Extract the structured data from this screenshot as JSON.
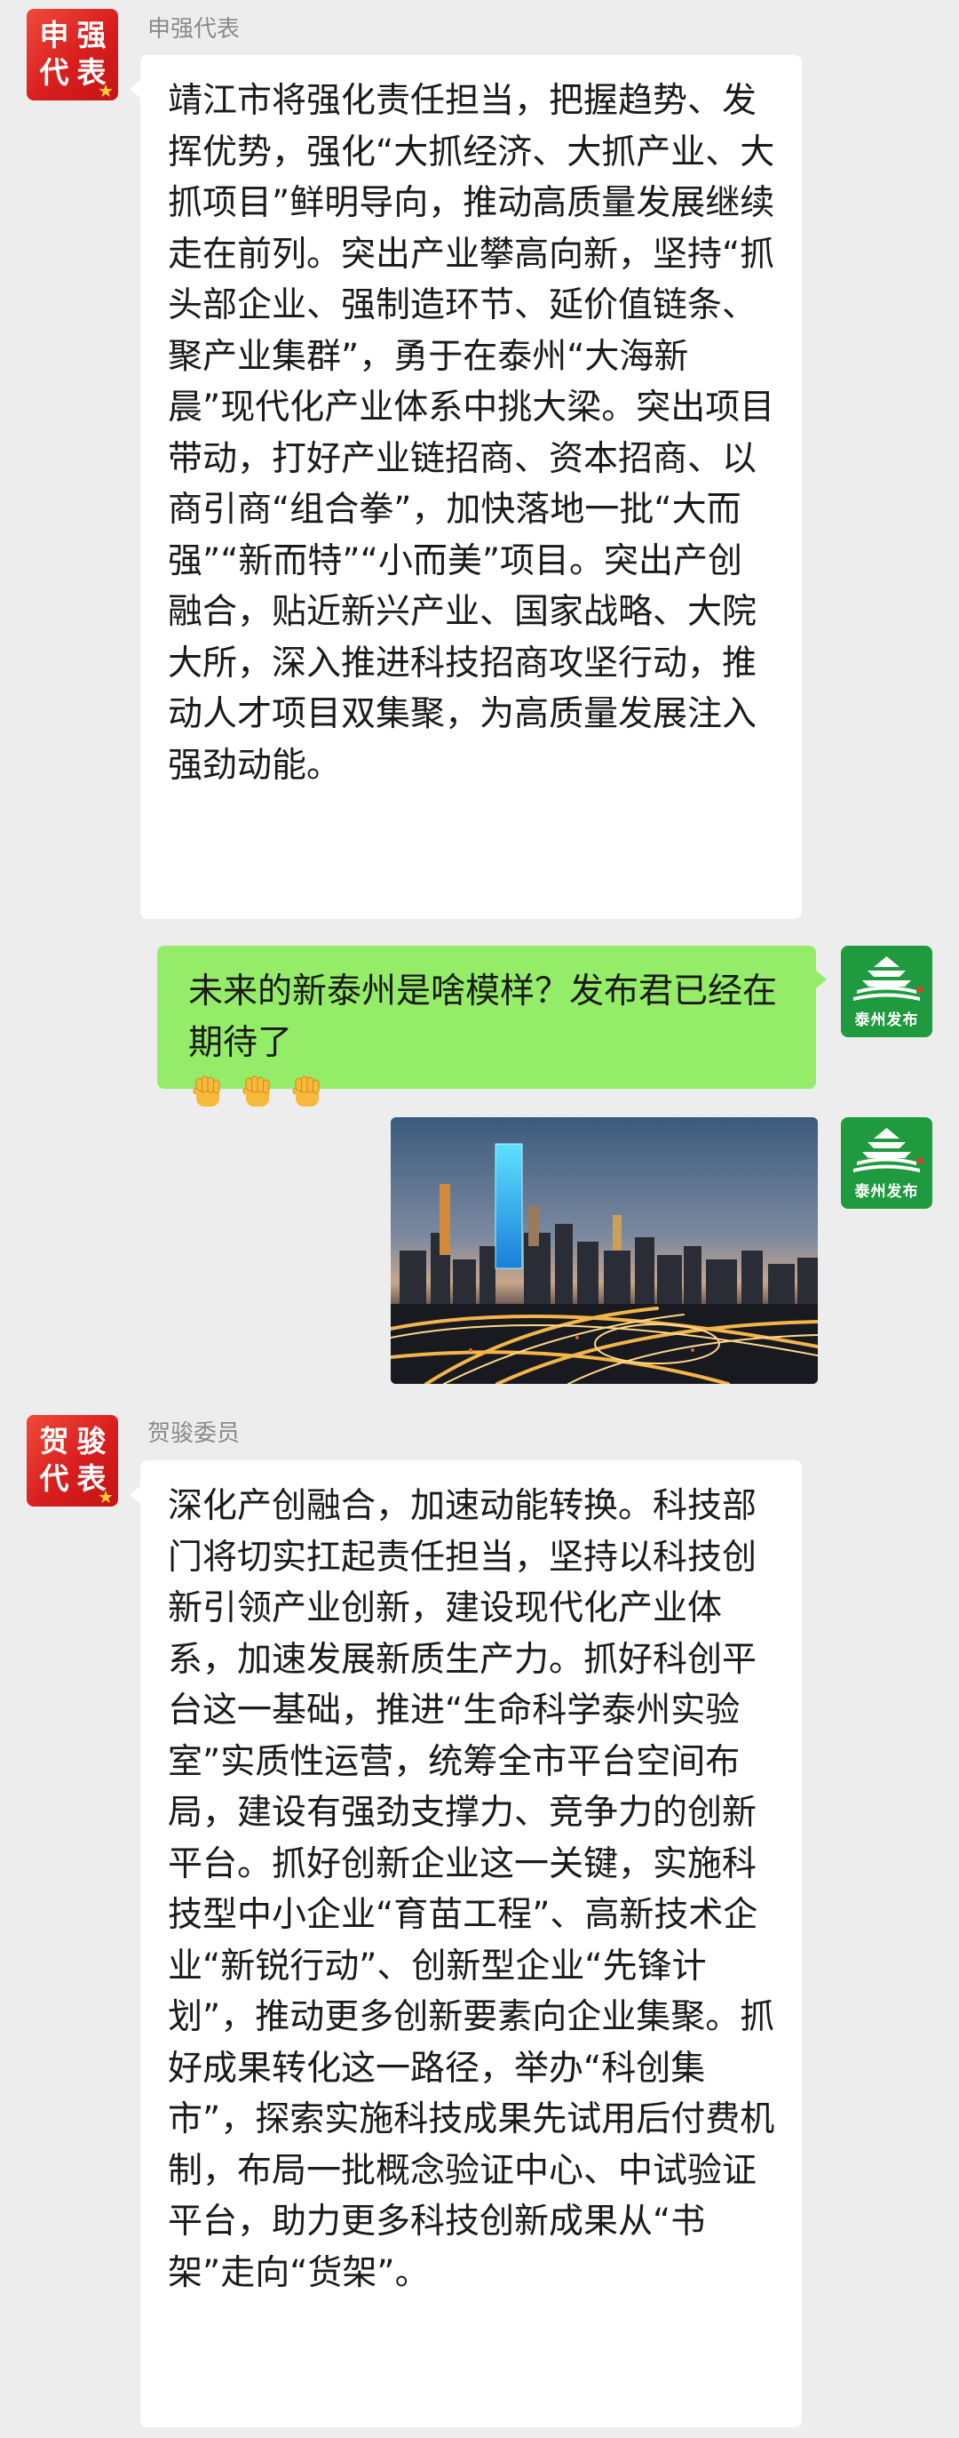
{
  "messages": [
    {
      "sender": "申强代表",
      "avatar_chars": [
        "申",
        "强",
        "代",
        "表"
      ],
      "text": "靖江市将强化责任担当，把握趋势、发挥优势，强化“大抓经济、大抓产业、大抓项目”鲜明导向，推动高质量发展继续走在前列。突出产业攀高向新，坚持“抓头部企业、强制造环节、延价值链条、聚产业集群”，勇于在泰州“大海新晨”现代化产业体系中挑大梁。突出项目带动，打好产业链招商、资本招商、以商引商“组合拳”，加快落地一批“大而强”“新而特”“小而美”项目。突出产创融合，贴近新兴产业、国家战略、大院大所，深入推进科技招商攻坚行动，推动人才项目双集聚，为高质量发展注入强劲动能。"
    },
    {
      "sender_avatar_caption": "泰州发布",
      "text": "未来的新泰州是啥模样？发布君已经在期待了",
      "emoji": [
        "fist-emoji",
        "fist-emoji",
        "fist-emoji"
      ]
    },
    {
      "sender_avatar_caption": "泰州发布",
      "image": "night-city-skyline-interchange-photo"
    },
    {
      "sender": "贺骏委员",
      "avatar_chars": [
        "贺",
        "骏",
        "代",
        "表"
      ],
      "text": "深化产创融合，加速动能转换。科技部门将切实扛起责任担当，坚持以科技创新引领产业创新，建设现代化产业体系，加速发展新质生产力。抓好科创平台这一基础，推进“生命科学泰州实验室”实质性运营，统筹全市平台空间布局，建设有强劲支撑力、竞争力的创新平台。抓好创新企业这一关键，实施科技型中小企业“育苗工程”、高新技术企业“新锐行动”、创新型企业“先锋计划”，推动更多创新要素向企业集聚。抓好成果转化这一路径，举办“科创集市”，探索实施科技成果先试用后付费机制，布局一批概念验证中心、中试验证平台，助力更多科技创新成果从“书架”走向“货架”。"
    }
  ],
  "colors": {
    "background": "#ededed",
    "self_bubble": "#95ec69",
    "other_bubble": "#ffffff",
    "name_text": "#8a8a8a"
  }
}
